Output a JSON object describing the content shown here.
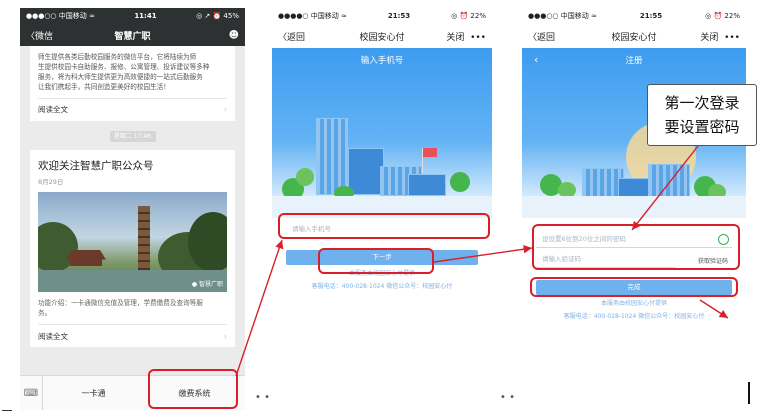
{
  "screen1": {
    "status": {
      "carrier": "●●●○○ 中国移动 ≈",
      "time": "11:41",
      "battery": "◎ ↗ ⏰ 45%"
    },
    "nav": {
      "back": "〈微信",
      "title": "智慧广职",
      "user_icon": "user-icon"
    },
    "article1": {
      "text_lines": [
        "师生提供各类后勤校园服务的微信平台，它将陆续为师",
        "生提供校园卡自助服务、报修、公寓管理、投诉建议等多种",
        "服务，将为科大师生提供更为高效便捷的一站式后勤服务",
        "让我们携起手，共同创造更美好的校园生活！"
      ],
      "read_all": "阅读全文"
    },
    "timestamp": "星期二 17:46",
    "article2": {
      "title": "欢迎关注智慧广职公众号",
      "date": "8月29日",
      "watermark": "● 智慧广职",
      "intro_lines": [
        "功能介绍：一卡通微信充值及管理，学费缴费及查询等服",
        "务。"
      ],
      "read_all": "阅读全文"
    },
    "footer": {
      "menu1": "一卡通",
      "menu2": "缴费系统"
    }
  },
  "screen2": {
    "status": {
      "carrier": "●●●●○ 中国移动 ≈",
      "time": "21:53",
      "battery": "◎ ⏰ 22%"
    },
    "nav": {
      "back": "〈返回",
      "title": "校园安心付",
      "close": "关闭",
      "more": "•••"
    },
    "header": "输入手机号",
    "phone_placeholder": "请输入手机号",
    "next_button": "下一步",
    "link": "本服务由校园安心付提供",
    "contact": "客服电话：400-028-1024  微信公众号：校园安心付"
  },
  "screen3": {
    "status": {
      "carrier": "●●●○○ 中国移动 ≈",
      "time": "21:55",
      "battery": "◎ ⏰ 22%"
    },
    "nav": {
      "back": "〈返回",
      "title": "校园安心付",
      "close": "关闭",
      "more": "•••"
    },
    "header": "注册",
    "password_placeholder": "设设置6位到20位之间的密码",
    "code_placeholder": "请输入验证码",
    "get_code": "获取验证码",
    "done_button": "完成",
    "link": "本服务由校园安心付提供",
    "contact": "客服电话：400-028-1024  微信公众号：校园安心付"
  },
  "annotation": {
    "line1": "第一次登录",
    "line2": "要设置密码"
  },
  "colors": {
    "accent_red": "#d9202a",
    "wechat_bar": "#2e3132",
    "blue": "#3d9cf0"
  }
}
